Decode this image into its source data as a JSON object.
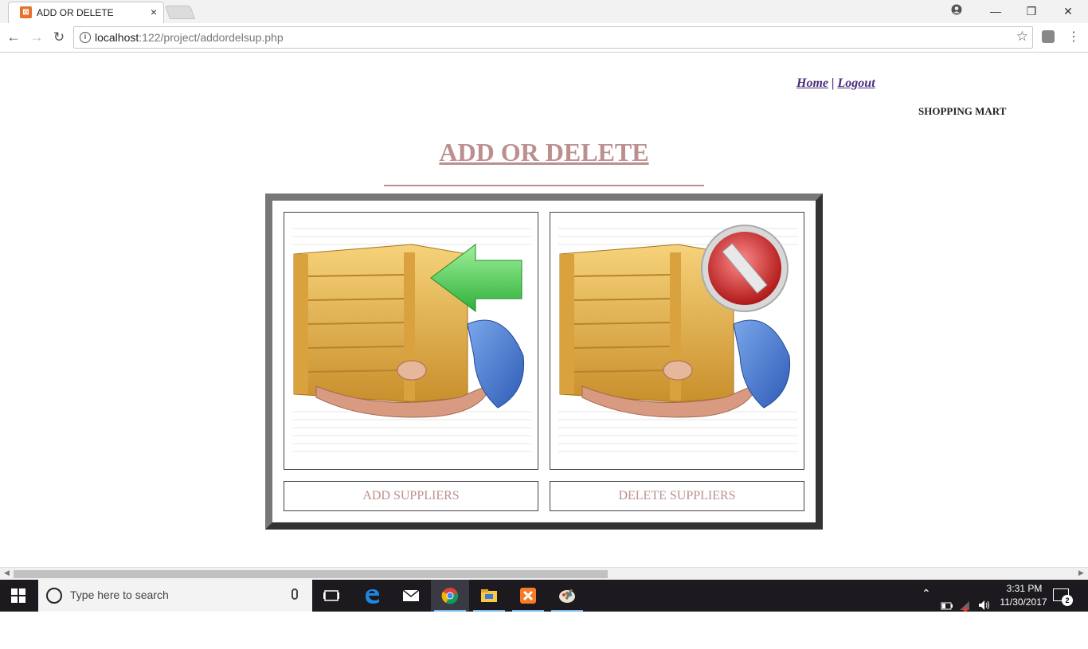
{
  "browser": {
    "tab_title": "ADD OR DELETE",
    "tab_close": "×",
    "url_host": "localhost",
    "url_path": ":122/project/addordelsup.php",
    "window_buttons": [
      "—",
      "❐",
      "✕"
    ]
  },
  "page": {
    "nav": {
      "home": "Home",
      "separator": "|",
      "logout": "Logout"
    },
    "brand": "SHOPPING MART",
    "heading": "ADD OR DELETE",
    "cards": [
      {
        "action_label": "ADD SUPPLIERS",
        "image_icon": "supplier-add-icon"
      },
      {
        "action_label": "DELETE SUPPLIERS",
        "image_icon": "supplier-delete-icon"
      }
    ],
    "colors": {
      "accent": "#bc8f8f",
      "link": "#4a2a7a",
      "panel_border": "#333333"
    }
  },
  "taskbar": {
    "search_placeholder": "Type here to search",
    "time": "3:31 PM",
    "date": "11/30/2017",
    "notification_count": "2"
  }
}
